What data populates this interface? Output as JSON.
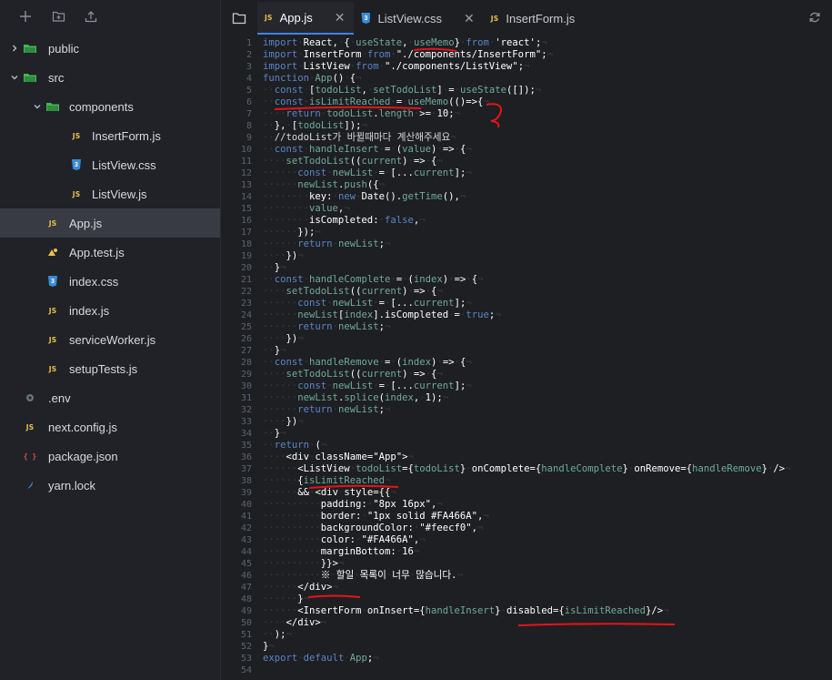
{
  "sidebar": {
    "toolbar": [
      "new-file-icon",
      "new-folder-icon",
      "upload-icon"
    ],
    "items": [
      {
        "label": "public",
        "icon": "folder-icon",
        "chevron": "right",
        "depth": 0
      },
      {
        "label": "src",
        "icon": "folder-icon",
        "chevron": "down",
        "depth": 0
      },
      {
        "label": "components",
        "icon": "folder-icon",
        "chevron": "down",
        "depth": 1
      },
      {
        "label": "InsertForm.js",
        "icon": "js-file-icon",
        "depth": 2
      },
      {
        "label": "ListView.css",
        "icon": "css-file-icon",
        "depth": 2
      },
      {
        "label": "ListView.js",
        "icon": "js-file-icon",
        "depth": 2
      },
      {
        "label": "App.js",
        "icon": "js-file-icon",
        "depth": 1,
        "active": true
      },
      {
        "label": "App.test.js",
        "icon": "test-file-icon",
        "depth": 1
      },
      {
        "label": "index.css",
        "icon": "css-file-icon",
        "depth": 1
      },
      {
        "label": "index.js",
        "icon": "js-file-icon",
        "depth": 1
      },
      {
        "label": "serviceWorker.js",
        "icon": "js-file-icon",
        "depth": 1
      },
      {
        "label": "setupTests.js",
        "icon": "js-file-icon",
        "depth": 1
      },
      {
        "label": ".env",
        "icon": "gear-icon",
        "depth": 0
      },
      {
        "label": "next.config.js",
        "icon": "js-file-icon",
        "depth": 0
      },
      {
        "label": "package.json",
        "icon": "json-file-icon",
        "depth": 0
      },
      {
        "label": "yarn.lock",
        "icon": "yarn-icon",
        "depth": 0
      }
    ]
  },
  "tabs": [
    {
      "label": "App.js",
      "icon": "js-file-icon",
      "active": true,
      "close": "✕"
    },
    {
      "label": "ListView.css",
      "icon": "css-file-icon",
      "active": false,
      "close": "✕"
    },
    {
      "label": "InsertForm.js",
      "icon": "js-file-icon",
      "active": false
    }
  ],
  "icon_text": {
    "js": "JS",
    "css": "3",
    "json": "{ }"
  },
  "colors": {
    "keyword": "#5b83c9",
    "identifier": "#6faa9c",
    "text": "#ffffff",
    "whitespace_marker": "#3a3c43",
    "line_number": "#5c6370",
    "annotation": "#e5141c",
    "active_tab_underline": "#3b82f6"
  },
  "code": [
    "import React, { useState, useMemo} from 'react';",
    "import InsertForm from \"./components/InsertForm\";",
    "import ListView from \"./components/ListView\";",
    "function App() {",
    "  const [todoList, setTodoList] = useState([]);",
    "  const isLimitReached = useMemo(()=>{",
    "    return todoList.length >= 10;",
    "  }, [todoList]);",
    "  //todoList가 바뀔때마다 계산해주세요",
    "  const handleInsert = (value) => {",
    "    setTodoList((current) => {",
    "      const newList = [...current];",
    "      newList.push({",
    "        key: new Date().getTime(),",
    "        value,",
    "        isCompleted: false,",
    "      });",
    "      return newList;",
    "    })",
    "  }",
    "  const handleComplete = (index) => {",
    "    setTodoList((current) => {",
    "      const newList = [...current];",
    "      newList[index].isCompleted = true;",
    "      return newList;",
    "    })",
    "  }",
    "  const handleRemove = (index) => {",
    "    setTodoList((current) => {",
    "      const newList = [...current];",
    "      newList.splice(index, 1);",
    "      return newList;",
    "    })",
    "  }",
    "  return (",
    "    <div className=\"App\">",
    "      <ListView todoList={todoList} onComplete={handleComplete} onRemove={handleRemove} />",
    "      {isLimitReached",
    "      && <div style={{",
    "          padding: \"8px 16px\",",
    "          border: \"1px solid #FA466A\",",
    "          backgroundColor: \"#feecf0\",",
    "          color: \"#FA466A\",",
    "          marginBottom: 16",
    "          }}>",
    "          ※ 할일 목록이 너무 많습니다.",
    "      </div>",
    "      }",
    "      <InsertForm onInsert={handleInsert} disabled={isLimitReached}/>",
    "    </div>",
    "  );",
    "}",
    "export default App;",
    ""
  ]
}
